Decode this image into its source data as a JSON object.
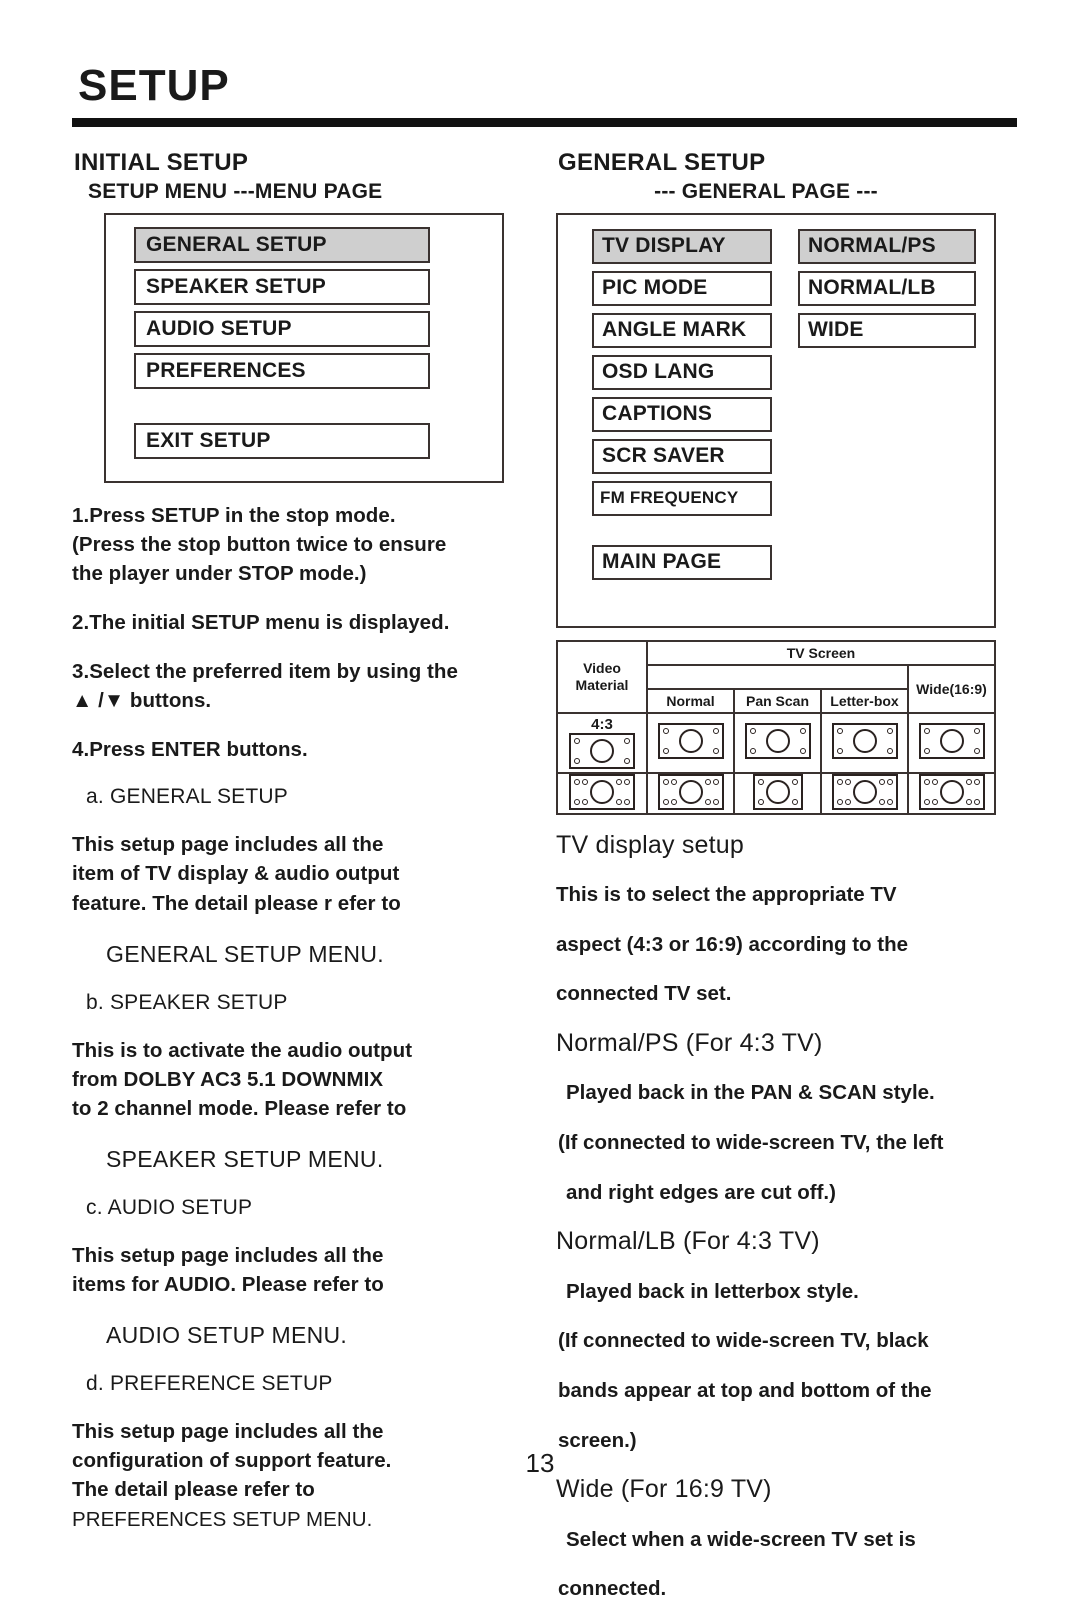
{
  "page": {
    "title": "SETUP",
    "number": "13"
  },
  "left_column": {
    "section_heading": "INITIAL SETUP",
    "menu_caption": "SETUP MENU  ---MENU PAGE",
    "osd_menu": {
      "items": [
        {
          "label": "GENERAL SETUP",
          "selected": true
        },
        {
          "label": "SPEAKER SETUP",
          "selected": false
        },
        {
          "label": "AUDIO SETUP",
          "selected": false
        },
        {
          "label": "PREFERENCES",
          "selected": false
        }
      ],
      "exit_item": {
        "label": "EXIT SETUP",
        "selected": false
      }
    },
    "steps": [
      "1.Press SETUP in the stop mode.",
      "(Press the stop button twice to ensure",
      " the player under STOP mode.)",
      "2.The initial SETUP menu is displayed.",
      "3.Select the preferred item by using the",
      "▲ /▼ buttons.",
      "4.Press ENTER buttons."
    ],
    "entries": [
      {
        "label": "a. GENERAL SETUP",
        "lines": [
          "This setup page includes all the",
          "item of TV display & audio output",
          "feature.  The detail please r efer to"
        ],
        "reference": "GENERAL SETUP MENU."
      },
      {
        "label": "b. SPEAKER SETUP",
        "lines": [
          "This is to activate the audio output",
          "from DOLBY AC3 5.1 DOWNMIX",
          "to 2 channel mode.  Please refer to"
        ],
        "reference": "SPEAKER SETUP MENU."
      },
      {
        "label": "c.  AUDIO SETUP",
        "lines": [
          "This setup page includes all the",
          "items for AUDIO.  Please refer to"
        ],
        "reference": "AUDIO SETUP MENU."
      },
      {
        "label": "d. PREFERENCE SETUP",
        "lines": [
          "This setup page includes all the",
          "configuration of support feature.",
          "The detail please refer to",
          "PREFERENCES SETUP MENU."
        ],
        "reference": ""
      }
    ]
  },
  "right_column": {
    "section_heading": "GENERAL SETUP",
    "menu_caption": "--- GENERAL PAGE ---",
    "osd_menu": {
      "column_a": [
        {
          "label": "TV DISPLAY",
          "selected": true
        },
        {
          "label": "PIC MODE",
          "selected": false
        },
        {
          "label": "ANGLE MARK",
          "selected": false
        },
        {
          "label": "OSD LANG",
          "selected": false
        },
        {
          "label": "CAPTIONS",
          "selected": false
        },
        {
          "label": "SCR SAVER",
          "selected": false
        },
        {
          "label": "FM FREQUENCY",
          "selected": false
        }
      ],
      "column_a_footer": {
        "label": "MAIN PAGE",
        "selected": false
      },
      "column_b": [
        {
          "label": "NORMAL/PS",
          "selected": true
        },
        {
          "label": "NORMAL/LB",
          "selected": false
        },
        {
          "label": "WIDE",
          "selected": false
        }
      ]
    },
    "tv_table": {
      "corner_label": "Video\nMaterial",
      "group_header": "TV Screen",
      "wide_header": "Wide(16:9)",
      "sub_headers": [
        "Normal",
        "Pan Scan",
        "Letter-box"
      ],
      "row_labels": [
        "4:3",
        ""
      ],
      "rows": [
        [
          {
            "style": "normal",
            "dots": "single"
          },
          {
            "style": "normal",
            "dots": "single"
          },
          {
            "style": "normal",
            "dots": "single"
          },
          {
            "style": "normal",
            "dots": "single"
          },
          {
            "style": "normal",
            "dots": "single"
          }
        ],
        [
          {
            "style": "normal",
            "dots": "double"
          },
          {
            "style": "normal",
            "dots": "double"
          },
          {
            "style": "narrow",
            "dots": "single"
          },
          {
            "style": "normal",
            "dots": "double"
          },
          {
            "style": "normal",
            "dots": "double"
          }
        ]
      ]
    },
    "tv_display": {
      "heading": "TV display setup",
      "intro": [
        "This is to select the appropriate TV",
        "aspect (4:3 or 16:9) according to the",
        "connected TV set."
      ],
      "modes": [
        {
          "title": "Normal/PS (For 4:3 TV)",
          "lines": [
            "Played back in the PAN & SCAN style.",
            "(If connected to wide-screen TV, the left",
            "and right edges are cut off.)"
          ]
        },
        {
          "title": "Normal/LB (For 4:3 TV)",
          "lines": [
            "Played back in letterbox style.",
            "(If connected to wide-screen TV, black",
            "bands appear at top and bottom of the",
            "screen.)"
          ]
        },
        {
          "title": "Wide (For 16:9 TV)",
          "lines": [
            "Select when a wide-screen TV set is",
            "connected."
          ]
        }
      ]
    }
  },
  "colors": {
    "ink": "#1a1a1a",
    "rule": "#111111",
    "border": "#3a3230",
    "highlight": "#cfcfcf",
    "background": "#ffffff"
  }
}
